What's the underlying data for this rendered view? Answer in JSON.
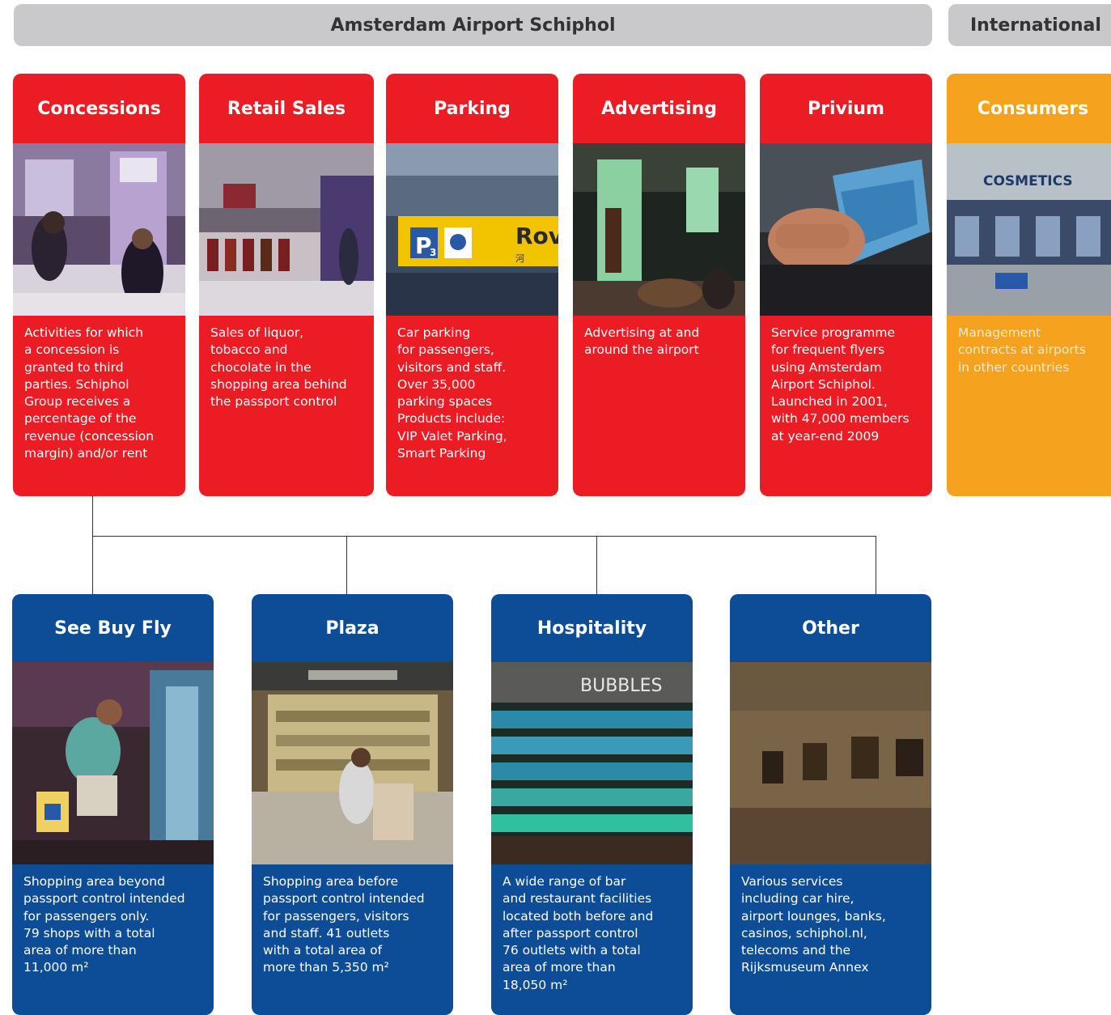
{
  "header": {
    "main_title": "Amsterdam Airport Schiphol",
    "side_title": "International"
  },
  "colors": {
    "red": "#ec1c24",
    "orange": "#f5a31e",
    "blue": "#0d4c97",
    "header_grey": "#c9c9cb"
  },
  "top_cards": [
    {
      "title": "Concessions",
      "text": "Activities for which\na concession is\ngranted to third\nparties. Schiphol\nGroup receives a\npercentage of the\nrevenue (concession\nmargin) and/or rent",
      "photo": "concessions-photo"
    },
    {
      "title": "Retail Sales",
      "text": "Sales of liquor,\ntobacco and\nchocolate in the\nshopping area behind\nthe passport control",
      "photo": "retail-sales-photo"
    },
    {
      "title": "Parking",
      "text": "Car parking\nfor passengers,\nvisitors and staff.\nOver 35,000\nparking spaces\nProducts include:\nVIP Valet Parking,\nSmart Parking",
      "photo": "parking-photo",
      "photo_text": {
        "p_sign": "P",
        "p_sub": "3",
        "sign": "Rov",
        "sign_sub": "河"
      }
    },
    {
      "title": "Advertising",
      "text": "Advertising at and\naround the airport",
      "photo": "advertising-photo"
    },
    {
      "title": "Privium",
      "text": "Service programme\nfor frequent flyers\nusing Amsterdam\nAirport Schiphol.\nLaunched in 2001,\nwith 47,000 members\nat year-end 2009",
      "photo": "privium-photo"
    },
    {
      "title": "Consumers",
      "text": "Management\ncontracts at airports\nin other countries",
      "photo": "consumers-photo",
      "photo_text": {
        "sign": "COSMETICS"
      }
    }
  ],
  "bottom_cards": [
    {
      "title": "See Buy Fly",
      "text": "Shopping area beyond\npassport control intended\nfor passengers only.\n79 shops with a total\narea of more than\n11,000 m²",
      "photo": "see-buy-fly-photo"
    },
    {
      "title": "Plaza",
      "text": "Shopping area before\npassport control intended\nfor passengers, visitors\nand staff. 41 outlets\nwith a total area of\nmore than 5,350 m²",
      "photo": "plaza-photo"
    },
    {
      "title": "Hospitality",
      "text": "A wide range of bar\nand restaurant facilities\nlocated both before and\nafter passport control\n76 outlets with a total\narea of more than\n18,050 m²",
      "photo": "hospitality-photo",
      "photo_text": {
        "sign": "BUBBLES"
      }
    },
    {
      "title": "Other",
      "text": "Various services\nincluding car hire,\nairport lounges, banks,\ncasinos, schiphol.nl,\ntelecoms and the\nRijksmuseum Annex",
      "photo": "other-photo"
    }
  ]
}
